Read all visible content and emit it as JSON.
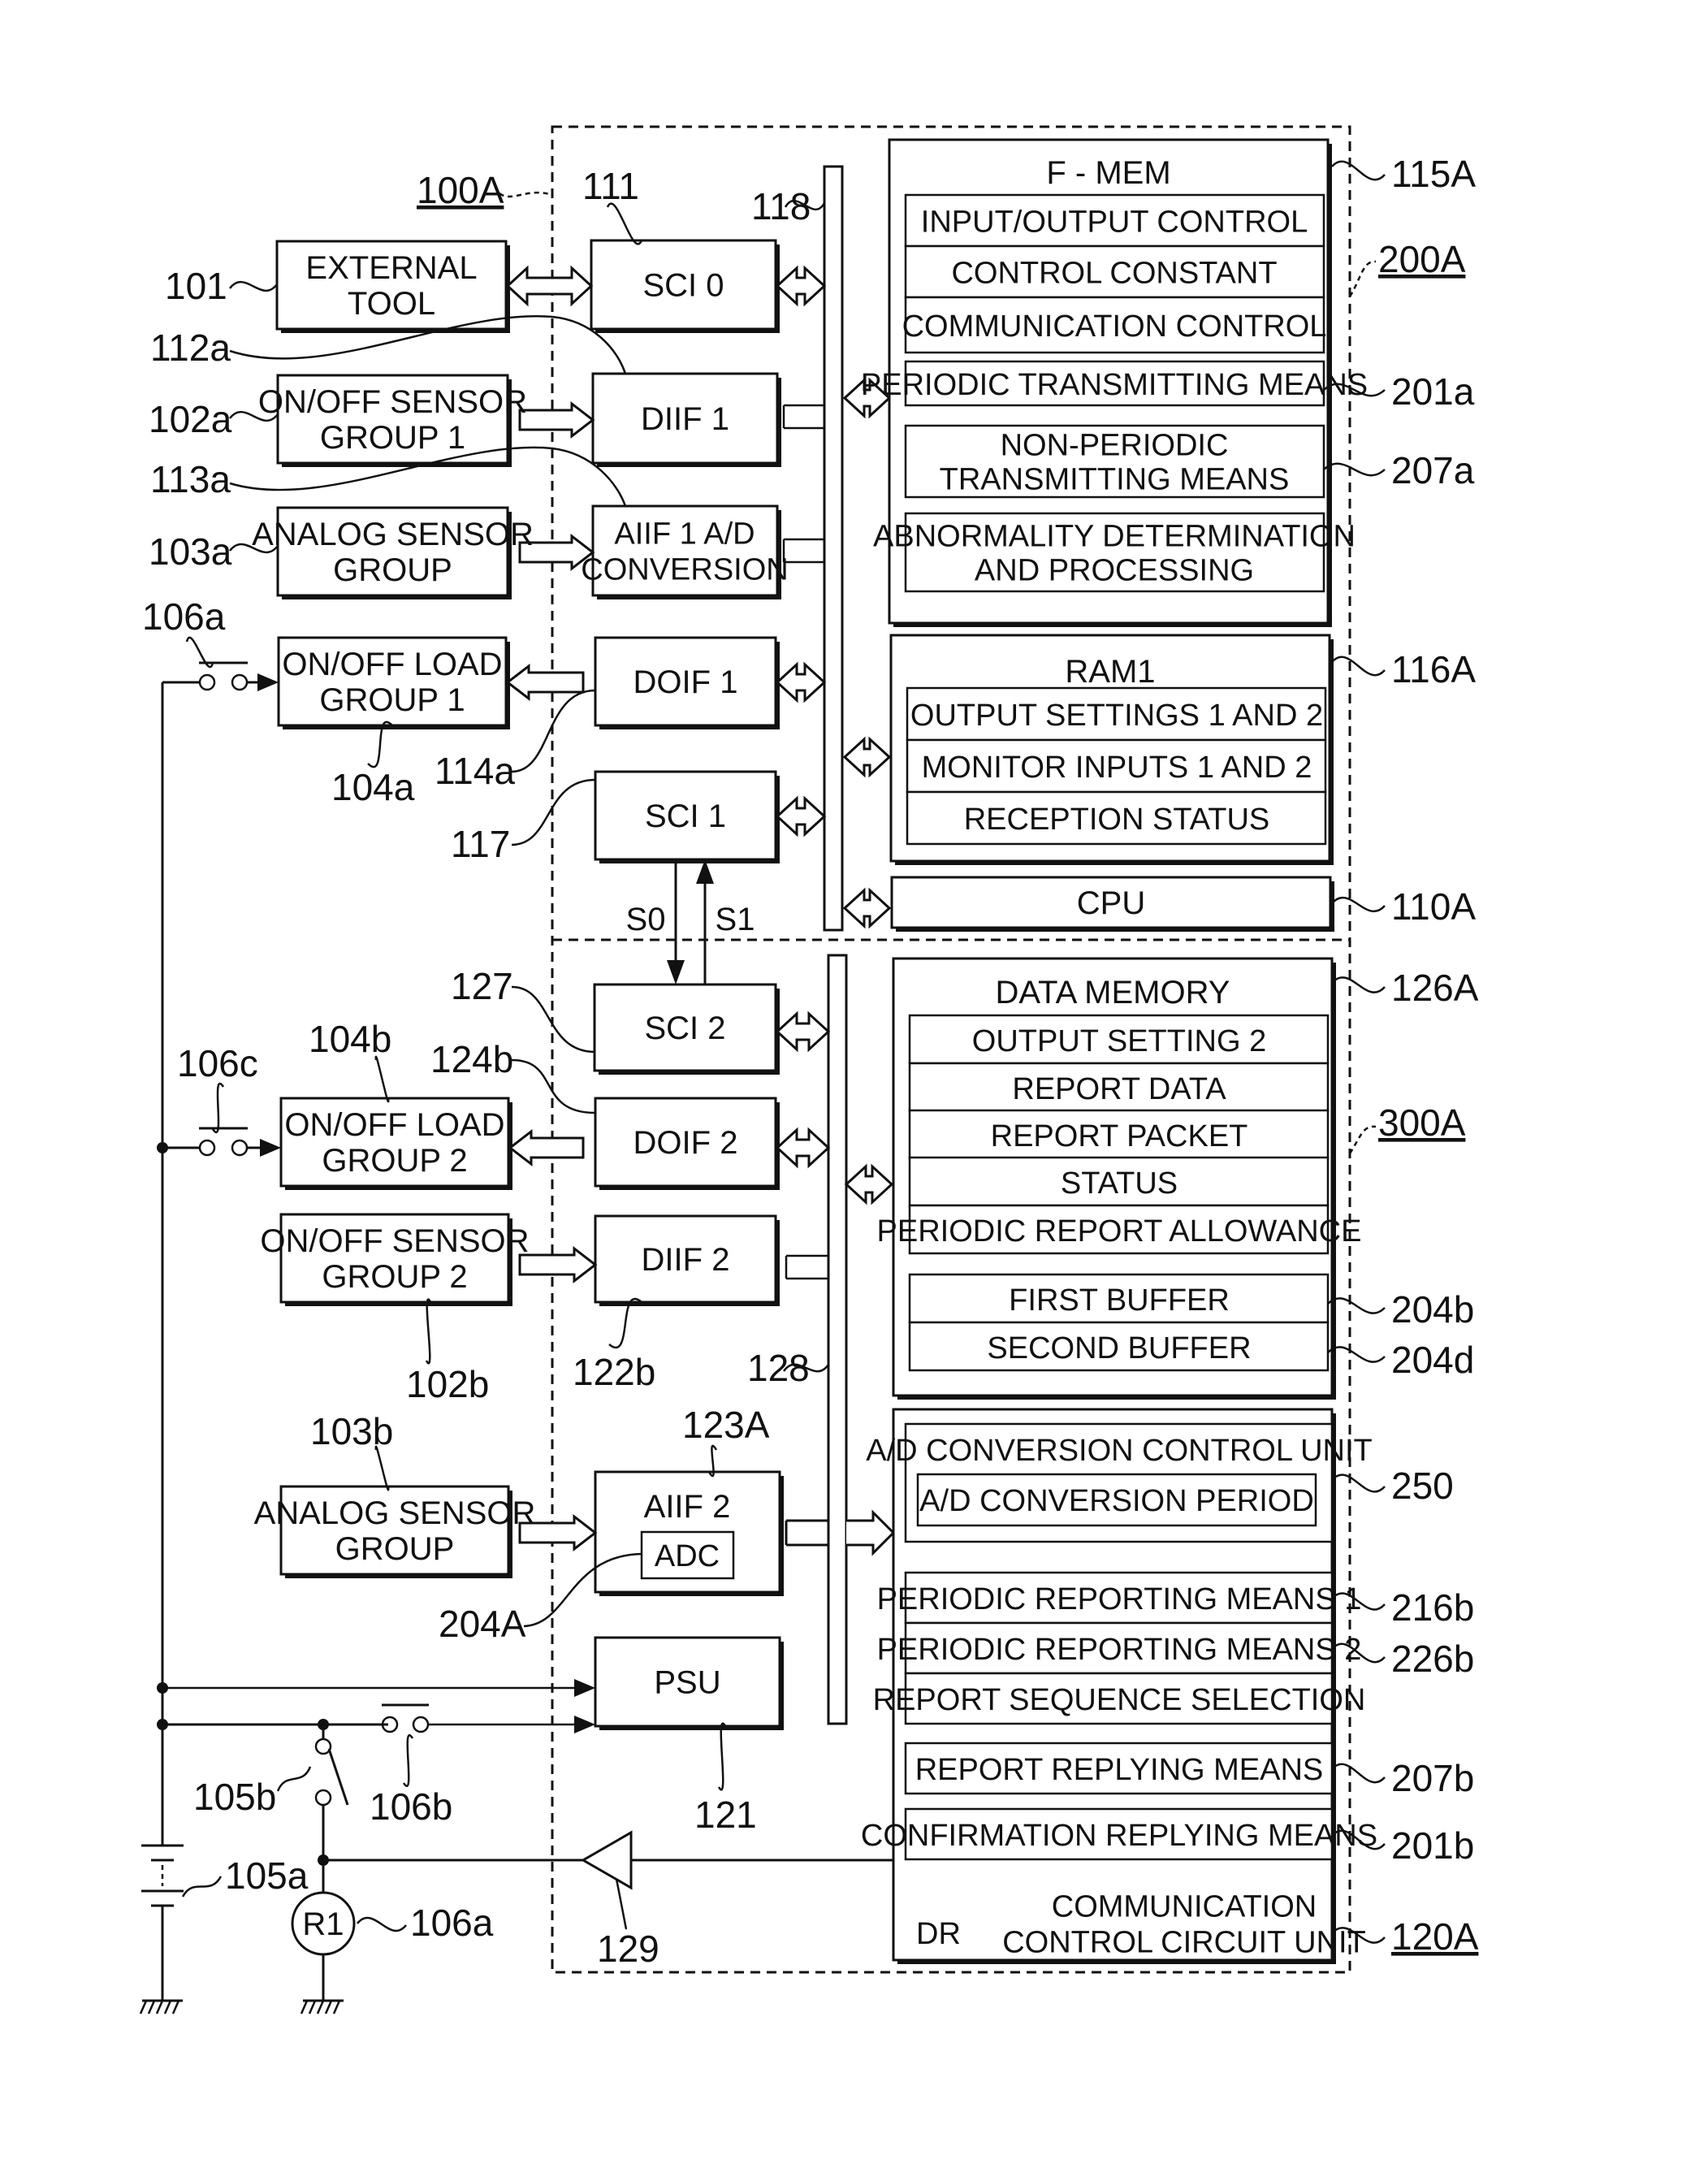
{
  "figure": {
    "outer_module_ref": "100A",
    "f_mem_group_ref": "200A",
    "data_mem_group_ref": "300A"
  },
  "left_blocks": {
    "external_tool": {
      "lines": [
        "EXTERNAL",
        "TOOL"
      ],
      "ref": "101"
    },
    "onoff_sensor_1": {
      "lines": [
        "ON/OFF SENSOR",
        "GROUP 1"
      ],
      "ref": "102a"
    },
    "analog_sensor_1": {
      "lines": [
        "ANALOG SENSOR",
        "GROUP"
      ],
      "ref": "103a"
    },
    "onoff_load_1": {
      "lines": [
        "ON/OFF LOAD",
        "GROUP 1"
      ],
      "ref": "104a"
    },
    "onoff_load_2": {
      "lines": [
        "ON/OFF LOAD",
        "GROUP 2"
      ],
      "ref": "104b"
    },
    "onoff_sensor_2": {
      "lines": [
        "ON/OFF SENSOR",
        "GROUP 2"
      ],
      "ref": "102b"
    },
    "analog_sensor_2": {
      "lines": [
        "ANALOG SENSOR",
        "GROUP"
      ],
      "ref": "103b"
    }
  },
  "interfaces": {
    "sci0": {
      "label": "SCI 0",
      "ref": "111"
    },
    "diif1": {
      "label": "DIIF 1",
      "ref": "112a"
    },
    "aiif1": {
      "lines": [
        "AIIF 1 A/D",
        "CONVERSION"
      ],
      "ref": "113a"
    },
    "doif1": {
      "label": "DOIF 1",
      "ref": "114a"
    },
    "sci1": {
      "label": "SCI 1",
      "ref": "117"
    },
    "sci2": {
      "label": "SCI 2",
      "ref": "127"
    },
    "doif2": {
      "label": "DOIF 2",
      "ref": "124b"
    },
    "diif2": {
      "label": "DIIF 2",
      "ref": "122b"
    },
    "aiif2": {
      "label": "AIIF 2",
      "ref": "123A",
      "adc_label": "ADC",
      "adc_ref": "204A"
    },
    "psu": {
      "label": "PSU",
      "ref": "121"
    }
  },
  "buses": {
    "upper_ref": "118",
    "lower_ref": "128"
  },
  "signals": {
    "s0": "S0",
    "s1": "S1"
  },
  "f_mem": {
    "title": "F - MEM",
    "ref": "115A",
    "rows": [
      {
        "text": "INPUT/OUTPUT CONTROL"
      },
      {
        "text": "CONTROL CONSTANT"
      },
      {
        "text": "COMMUNICATION CONTROL"
      }
    ],
    "periodic_transmitting": {
      "text": "PERIODIC TRANSMITTING MEANS",
      "ref": "201a"
    },
    "non_periodic": {
      "lines": [
        "NON-PERIODIC",
        "TRANSMITTING MEANS"
      ],
      "ref": "207a"
    },
    "abnormality": {
      "lines": [
        "ABNORMALITY DETERMINATION",
        "AND PROCESSING"
      ]
    }
  },
  "ram1": {
    "title": "RAM1",
    "ref": "116A",
    "rows": [
      "OUTPUT SETTINGS 1 AND 2",
      "MONITOR INPUTS 1 AND 2",
      "RECEPTION STATUS"
    ]
  },
  "cpu": {
    "label": "CPU",
    "ref": "110A"
  },
  "data_memory": {
    "title": "DATA MEMORY",
    "ref": "126A",
    "rows": [
      "OUTPUT SETTING 2",
      "REPORT DATA",
      "REPORT PACKET",
      "STATUS",
      "PERIODIC REPORT ALLOWANCE"
    ],
    "first_buffer": {
      "text": "FIRST BUFFER",
      "ref": "204b"
    },
    "second_buffer": {
      "text": "SECOND BUFFER",
      "ref": "204d"
    }
  },
  "comm_control": {
    "ref": "120A",
    "ad_unit": {
      "title": "A/D CONVERSION CONTROL UNIT",
      "period": "A/D CONVERSION PERIOD",
      "ref": "250"
    },
    "periodic_1": {
      "text": "PERIODIC REPORTING MEANS 1",
      "ref": "216b"
    },
    "periodic_2": {
      "text": "PERIODIC REPORTING MEANS 2",
      "ref": "226b"
    },
    "sequence": {
      "text": "REPORT SEQUENCE SELECTION"
    },
    "report_replying": {
      "text": "REPORT REPLYING MEANS",
      "ref": "207b"
    },
    "confirmation_replying": {
      "text": "CONFIRMATION REPLYING MEANS",
      "ref": "201b"
    },
    "dr_label": "DR",
    "unit_lines": [
      "COMMUNICATION",
      "CONTROL CIRCUIT UNIT"
    ]
  },
  "circuit": {
    "switch_106a": "106a",
    "switch_106c": "106c",
    "switch_106b": "106b",
    "switch_105b": "105b",
    "battery_105a": "105a",
    "relay_label": "R1",
    "relay_ref": "106a",
    "driver_ref": "129"
  }
}
